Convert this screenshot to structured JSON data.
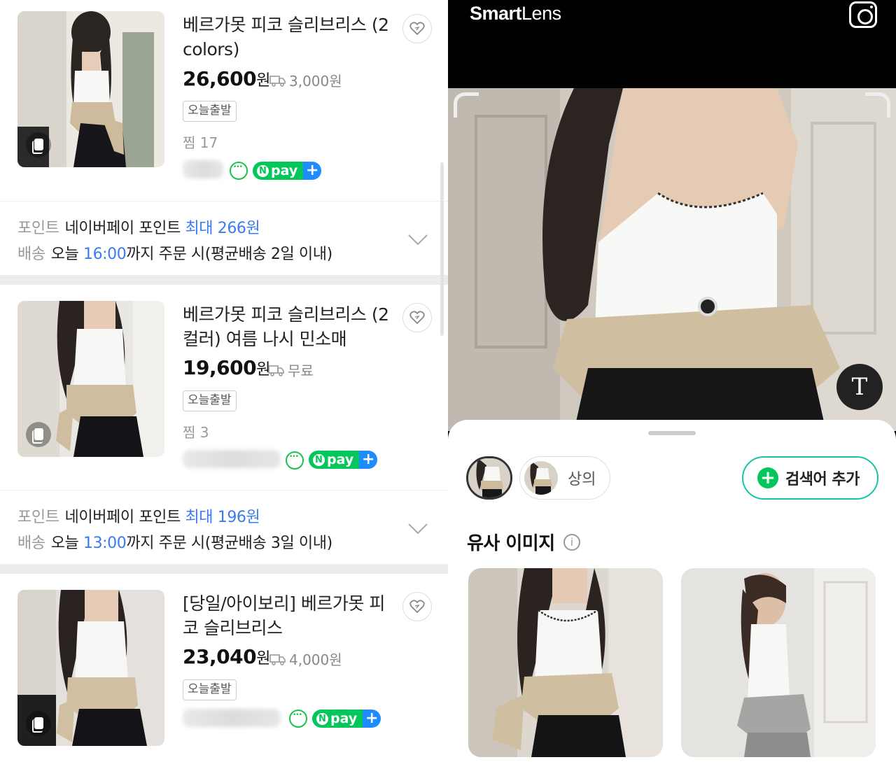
{
  "products": [
    {
      "title": "베르가못 피코 슬리브리스 (2 colors)",
      "price": "26,600",
      "won": "원",
      "shipping": "3,000원",
      "tag": "오늘출발",
      "zzim": "찜 17",
      "point_key": "포인트",
      "point_text": "네이버페이 포인트",
      "point_value": "최대 266원",
      "ship_key": "배송",
      "ship_prefix": "오늘",
      "ship_time": "16:00",
      "ship_suffix": "까지 주문 시(평균배송 2일 이내)",
      "npay": "pay"
    },
    {
      "title": "베르가못 피코 슬리브리스 (2 컬러) 여름 나시 민소매",
      "price": "19,600",
      "won": "원",
      "shipping": "무료",
      "tag": "오늘출발",
      "zzim": "찜 3",
      "point_key": "포인트",
      "point_text": "네이버페이 포인트",
      "point_value": "최대 196원",
      "ship_key": "배송",
      "ship_prefix": "오늘",
      "ship_time": "13:00",
      "ship_suffix": "까지 주문 시(평균배송 3일 이내)",
      "npay": "pay"
    },
    {
      "title": "[당일/아이보리] 베르가못 피코 슬리브리스",
      "price": "23,040",
      "won": "원",
      "shipping": "4,000원",
      "tag": "오늘출발",
      "npay": "pay"
    }
  ],
  "smartlens": {
    "logo_smart": "Smart",
    "logo_lens": "Lens",
    "text_button": "T",
    "chip_label": "상의",
    "add_keyword": "검색어 추가",
    "similar_title": "유사 이미지",
    "info_glyph": "i"
  },
  "colors": {
    "accent_blue": "#3a7bf0",
    "npay_green": "#03c75a",
    "plus_blue": "#1e8cff",
    "teal_border": "#14c6a8"
  }
}
